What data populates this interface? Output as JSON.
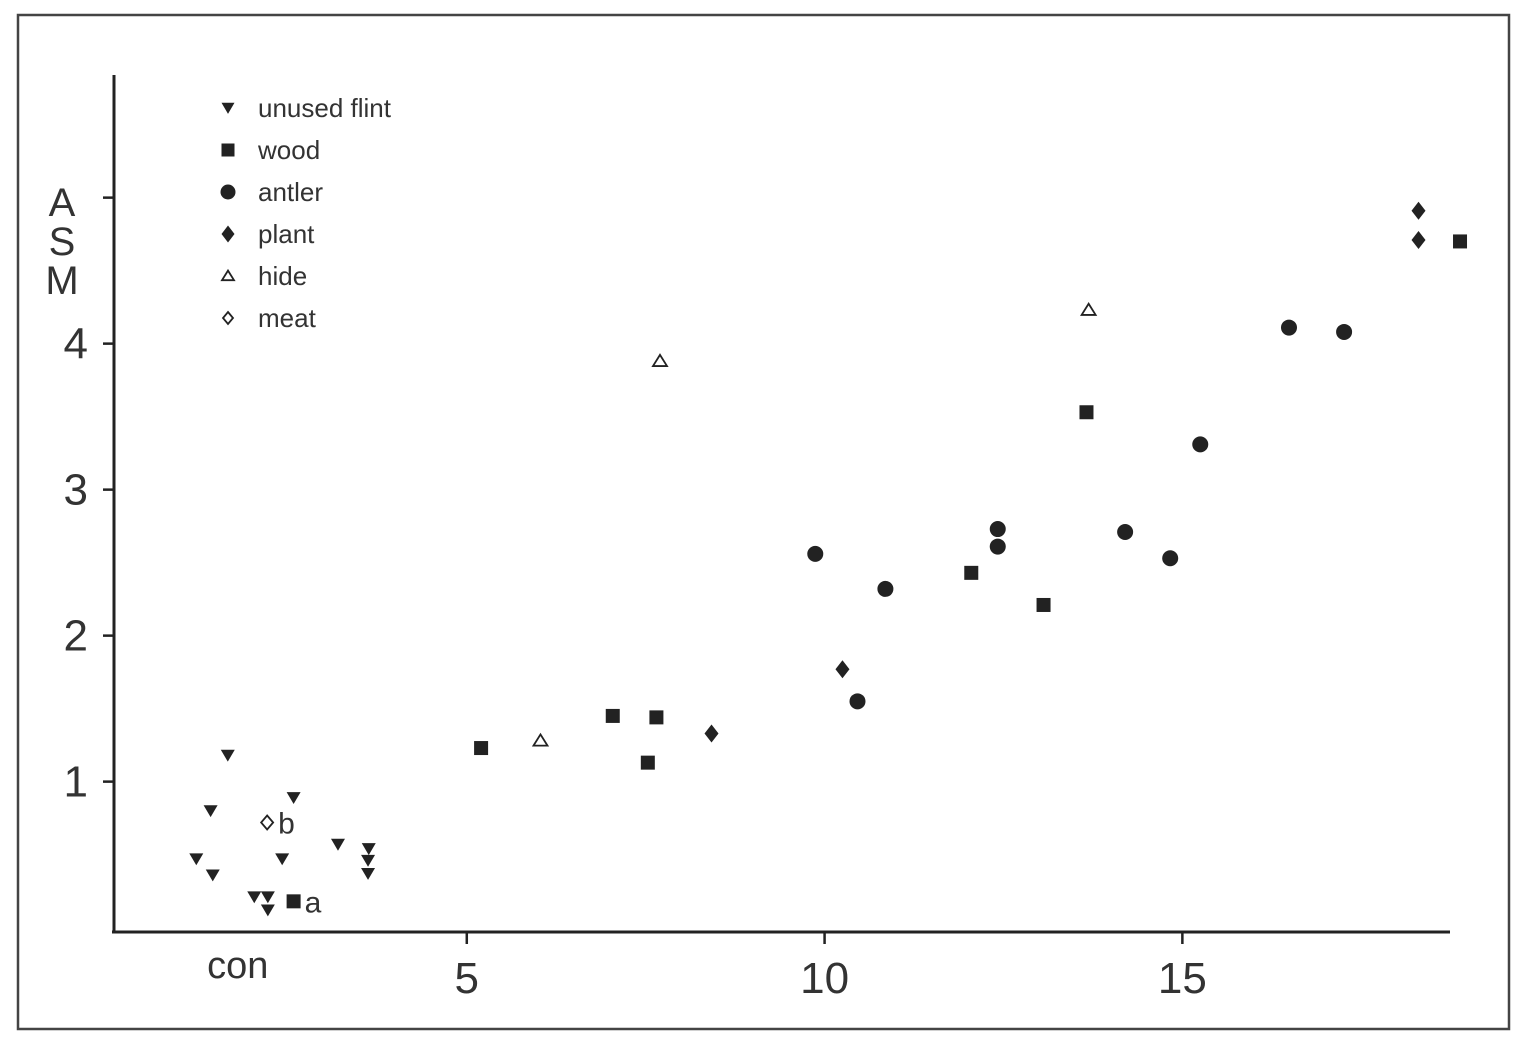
{
  "chart_data": {
    "type": "scatter",
    "title": "",
    "xlabel": "",
    "ylabel": "ASM",
    "xlim": [
      0.07,
      18.74
    ],
    "ylim": [
      -0.03,
      5.84
    ],
    "x_ticks": [
      {
        "value": 1.8,
        "label": "con",
        "tick": false
      },
      {
        "value": 5,
        "label": "5",
        "tick": true
      },
      {
        "value": 10,
        "label": "10",
        "tick": true
      },
      {
        "value": 15,
        "label": "15",
        "tick": true
      }
    ],
    "y_ticks": [
      {
        "value": 1,
        "label": "1"
      },
      {
        "value": 2,
        "label": "2"
      },
      {
        "value": 3,
        "label": "3"
      },
      {
        "value": 4,
        "label": "4"
      },
      {
        "value": 5,
        "label": ""
      }
    ],
    "grid": false,
    "legend_position": "top-left",
    "color": "#222222",
    "series": [
      {
        "name": "unused flint",
        "marker": "triangle-down-filled",
        "points": [
          [
            1.66,
            1.18
          ],
          [
            1.42,
            0.8
          ],
          [
            2.58,
            0.89
          ],
          [
            1.22,
            0.47
          ],
          [
            1.45,
            0.36
          ],
          [
            2.42,
            0.47
          ],
          [
            3.2,
            0.57
          ],
          [
            3.63,
            0.54
          ],
          [
            3.62,
            0.46
          ],
          [
            3.62,
            0.37
          ],
          [
            2.03,
            0.21
          ],
          [
            2.22,
            0.21
          ],
          [
            2.22,
            0.12
          ]
        ]
      },
      {
        "name": "wood",
        "marker": "square-filled",
        "points": [
          [
            2.58,
            0.18
          ],
          [
            5.2,
            1.23
          ],
          [
            7.04,
            1.45
          ],
          [
            7.65,
            1.44
          ],
          [
            7.53,
            1.13
          ],
          [
            12.05,
            2.43
          ],
          [
            13.06,
            2.21
          ],
          [
            13.66,
            3.53
          ],
          [
            18.88,
            4.7
          ]
        ]
      },
      {
        "name": "antler",
        "marker": "circle-filled",
        "points": [
          [
            9.87,
            2.56
          ],
          [
            10.85,
            2.32
          ],
          [
            10.46,
            1.55
          ],
          [
            12.42,
            2.73
          ],
          [
            12.42,
            2.61
          ],
          [
            14.2,
            2.71
          ],
          [
            14.83,
            2.53
          ],
          [
            15.25,
            3.31
          ],
          [
            16.49,
            4.11
          ],
          [
            17.26,
            4.08
          ]
        ]
      },
      {
        "name": "plant",
        "marker": "diamond-filled",
        "points": [
          [
            8.42,
            1.33
          ],
          [
            10.25,
            1.77
          ],
          [
            18.3,
            4.91
          ],
          [
            18.3,
            4.71
          ]
        ]
      },
      {
        "name": "hide",
        "marker": "triangle-up-open",
        "points": [
          [
            6.03,
            1.28
          ],
          [
            7.7,
            3.88
          ],
          [
            13.69,
            4.23
          ]
        ]
      },
      {
        "name": "meat",
        "marker": "diamond-open",
        "points": [
          [
            2.21,
            0.72
          ]
        ]
      }
    ],
    "annotations": [
      {
        "text": "a",
        "x": 2.58,
        "y": 0.18
      },
      {
        "text": "b",
        "x": 2.21,
        "y": 0.72
      }
    ]
  }
}
